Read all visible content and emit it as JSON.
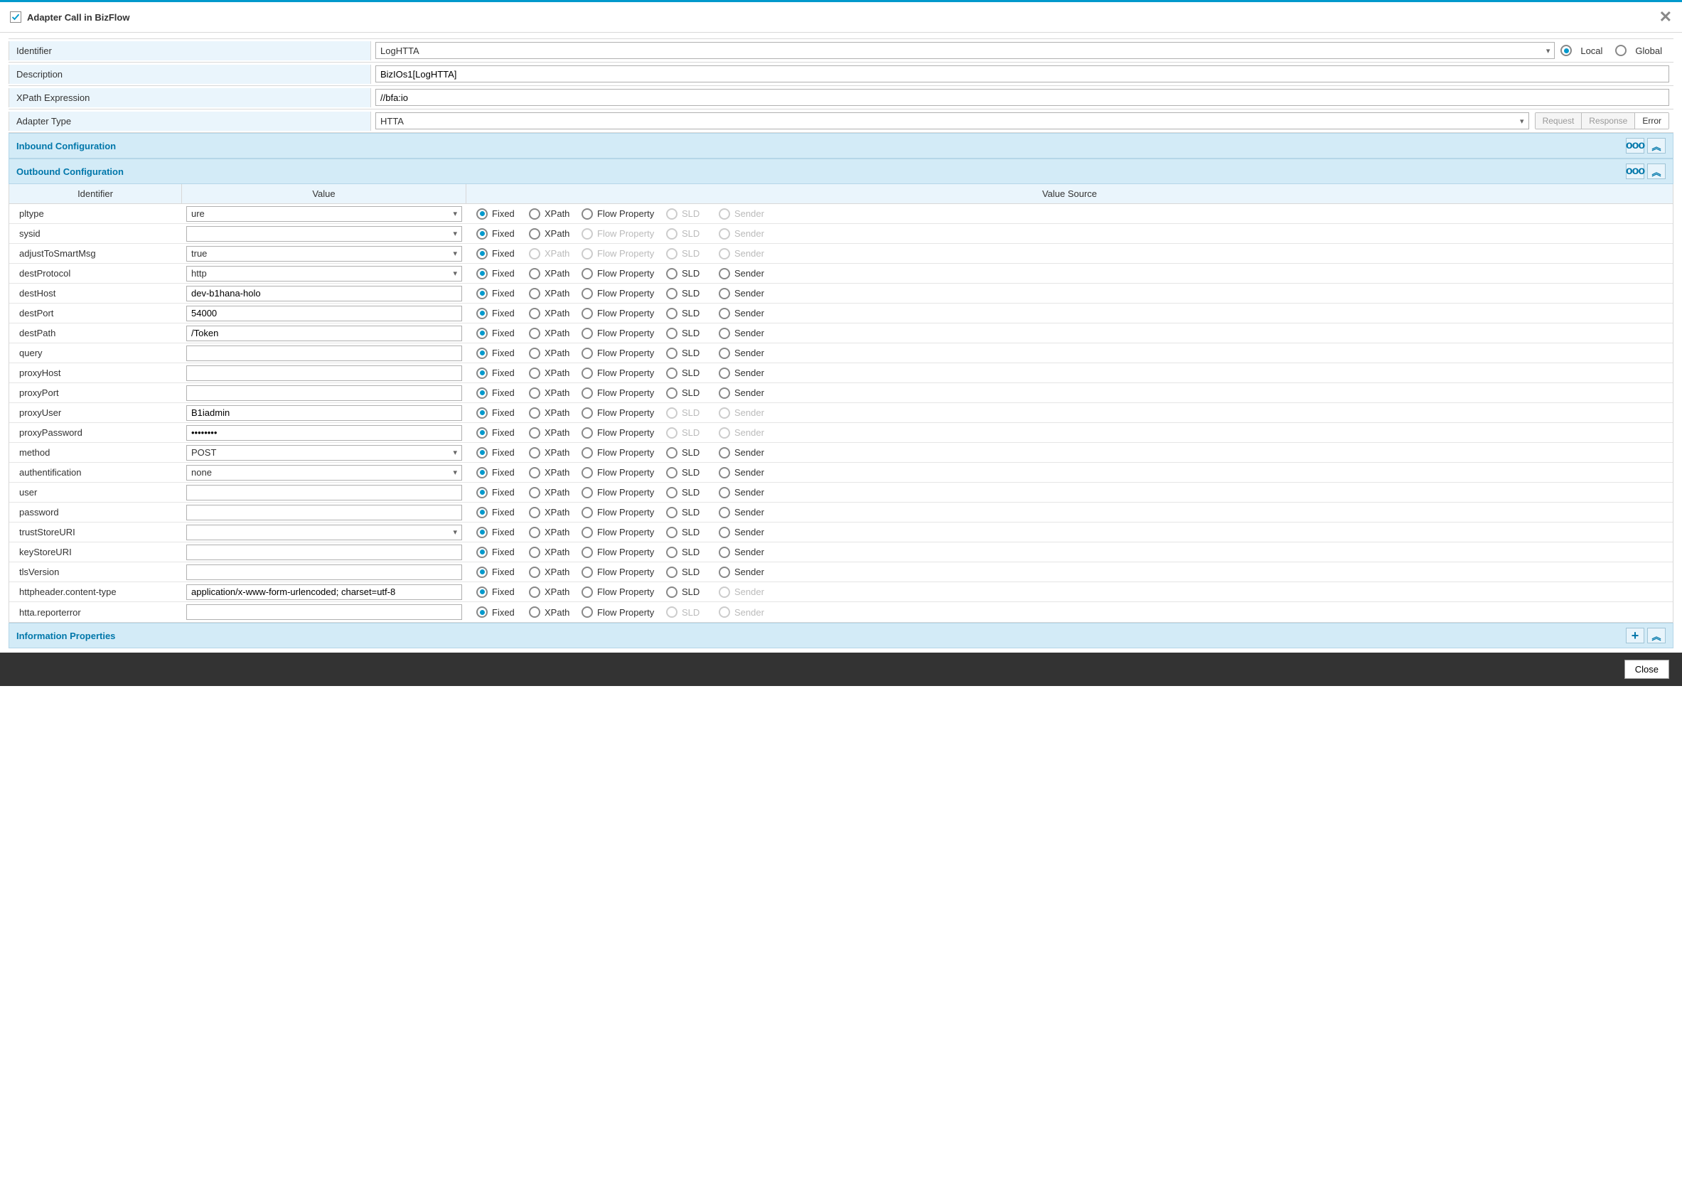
{
  "dialog": {
    "title": "Adapter Call in BizFlow",
    "close_label": "Close"
  },
  "form": {
    "identifier_label": "Identifier",
    "identifier_value": "LogHTTA",
    "scope_local": "Local",
    "scope_global": "Global",
    "description_label": "Description",
    "description_value": "BizIOs1[LogHTTA]",
    "xpath_label": "XPath Expression",
    "xpath_value": "//bfa:io",
    "adapter_type_label": "Adapter Type",
    "adapter_type_value": "HTTA",
    "btn_request": "Request",
    "btn_response": "Response",
    "btn_error": "Error"
  },
  "sections": {
    "inbound": "Inbound Configuration",
    "outbound": "Outbound Configuration",
    "info_props": "Information Properties"
  },
  "grid": {
    "col_identifier": "Identifier",
    "col_value": "Value",
    "col_source": "Value Source",
    "src_fixed": "Fixed",
    "src_xpath": "XPath",
    "src_flow": "Flow Property",
    "src_sld": "SLD",
    "src_sender": "Sender"
  },
  "rows": [
    {
      "id": "pltype",
      "value": "ure",
      "type": "select",
      "enabled": {
        "fixed": true,
        "xpath": true,
        "flow": true,
        "sld": false,
        "sender": false
      }
    },
    {
      "id": "sysid",
      "value": "",
      "type": "select",
      "enabled": {
        "fixed": true,
        "xpath": true,
        "flow": false,
        "sld": false,
        "sender": false
      }
    },
    {
      "id": "adjustToSmartMsg",
      "value": "true",
      "type": "select",
      "enabled": {
        "fixed": true,
        "xpath": false,
        "flow": false,
        "sld": false,
        "sender": false
      }
    },
    {
      "id": "destProtocol",
      "value": "http",
      "type": "select",
      "enabled": {
        "fixed": true,
        "xpath": true,
        "flow": true,
        "sld": true,
        "sender": true
      }
    },
    {
      "id": "destHost",
      "value": "dev-b1hana-holo",
      "type": "text",
      "enabled": {
        "fixed": true,
        "xpath": true,
        "flow": true,
        "sld": true,
        "sender": true
      }
    },
    {
      "id": "destPort",
      "value": "54000",
      "type": "text",
      "enabled": {
        "fixed": true,
        "xpath": true,
        "flow": true,
        "sld": true,
        "sender": true
      }
    },
    {
      "id": "destPath",
      "value": "/Token",
      "type": "text",
      "enabled": {
        "fixed": true,
        "xpath": true,
        "flow": true,
        "sld": true,
        "sender": true
      }
    },
    {
      "id": "query",
      "value": "",
      "type": "text",
      "enabled": {
        "fixed": true,
        "xpath": true,
        "flow": true,
        "sld": true,
        "sender": true
      }
    },
    {
      "id": "proxyHost",
      "value": "",
      "type": "text",
      "enabled": {
        "fixed": true,
        "xpath": true,
        "flow": true,
        "sld": true,
        "sender": true
      }
    },
    {
      "id": "proxyPort",
      "value": "",
      "type": "text",
      "enabled": {
        "fixed": true,
        "xpath": true,
        "flow": true,
        "sld": true,
        "sender": true
      }
    },
    {
      "id": "proxyUser",
      "value": "B1iadmin",
      "type": "text",
      "enabled": {
        "fixed": true,
        "xpath": true,
        "flow": true,
        "sld": false,
        "sender": false
      }
    },
    {
      "id": "proxyPassword",
      "value": "••••••••",
      "type": "text",
      "enabled": {
        "fixed": true,
        "xpath": true,
        "flow": true,
        "sld": false,
        "sender": false
      }
    },
    {
      "id": "method",
      "value": "POST",
      "type": "select",
      "enabled": {
        "fixed": true,
        "xpath": true,
        "flow": true,
        "sld": true,
        "sender": true
      }
    },
    {
      "id": "authentification",
      "value": "none",
      "type": "select",
      "enabled": {
        "fixed": true,
        "xpath": true,
        "flow": true,
        "sld": true,
        "sender": true
      }
    },
    {
      "id": "user",
      "value": "",
      "type": "text",
      "enabled": {
        "fixed": true,
        "xpath": true,
        "flow": true,
        "sld": true,
        "sender": true
      }
    },
    {
      "id": "password",
      "value": "",
      "type": "text",
      "enabled": {
        "fixed": true,
        "xpath": true,
        "flow": true,
        "sld": true,
        "sender": true
      }
    },
    {
      "id": "trustStoreURI",
      "value": "",
      "type": "select",
      "enabled": {
        "fixed": true,
        "xpath": true,
        "flow": true,
        "sld": true,
        "sender": true
      }
    },
    {
      "id": "keyStoreURI",
      "value": "",
      "type": "text",
      "enabled": {
        "fixed": true,
        "xpath": true,
        "flow": true,
        "sld": true,
        "sender": true
      }
    },
    {
      "id": "tlsVersion",
      "value": "",
      "type": "text",
      "enabled": {
        "fixed": true,
        "xpath": true,
        "flow": true,
        "sld": true,
        "sender": true
      }
    },
    {
      "id": "httpheader.content-type",
      "value": "application/x-www-form-urlencoded; charset=utf-8",
      "type": "text",
      "enabled": {
        "fixed": true,
        "xpath": true,
        "flow": true,
        "sld": true,
        "sender": false
      }
    },
    {
      "id": "htta.reporterror",
      "value": "",
      "type": "text",
      "enabled": {
        "fixed": true,
        "xpath": true,
        "flow": true,
        "sld": false,
        "sender": false
      }
    }
  ]
}
